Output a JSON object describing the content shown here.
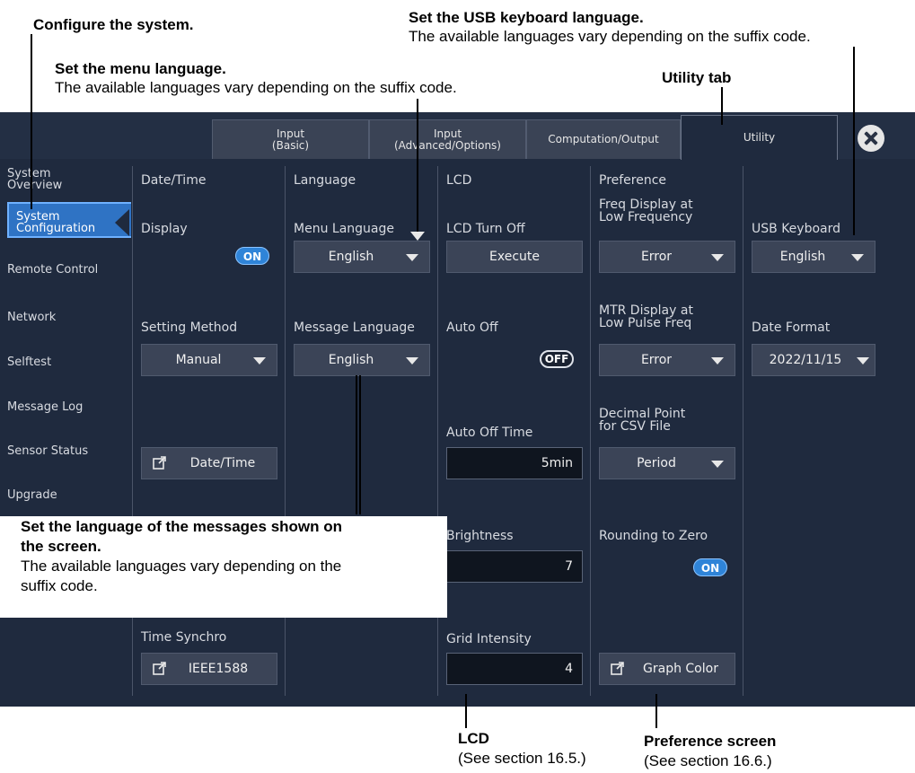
{
  "annotations": {
    "configure": "Configure the system.",
    "usb_title": "Set the USB keyboard language.",
    "usb_body": "The available languages vary depending on the suffix code.",
    "menu_title": "Set the menu language.",
    "menu_body": "The available languages vary depending on the suffix code.",
    "utility_tab": "Utility tab",
    "msg_title_1": "Set the language of the messages shown on",
    "msg_title_2": "the screen.",
    "msg_body_1": "The available languages vary depending on the",
    "msg_body_2": "suffix code.",
    "lcd_title": "LCD",
    "lcd_ref": "(See section 16.5.)",
    "pref_title": "Preference screen",
    "pref_ref": "(See section 16.6.)"
  },
  "tabs": [
    {
      "line1": "Input",
      "line2": "(Basic)"
    },
    {
      "line1": "Input",
      "line2": "(Advanced/Options)"
    },
    {
      "line1": "Computation/Output",
      "line2": ""
    },
    {
      "line1": "Utility",
      "line2": ""
    }
  ],
  "sidebar": [
    {
      "line1": "System",
      "line2": "Overview"
    },
    {
      "line1": "System",
      "line2": "Configuration"
    },
    {
      "line1": "Remote Control",
      "line2": ""
    },
    {
      "line1": "Network",
      "line2": ""
    },
    {
      "line1": "Selftest",
      "line2": ""
    },
    {
      "line1": "Message Log",
      "line2": ""
    },
    {
      "line1": "Sensor Status",
      "line2": ""
    },
    {
      "line1": "Upgrade",
      "line2": ""
    }
  ],
  "datetime": {
    "header": "Date/Time",
    "display_label": "Display",
    "display_value": "ON",
    "setting_method_label": "Setting Method",
    "setting_method_value": "Manual",
    "datetime_button": "Date/Time",
    "time_synchro_label": "Time Synchro",
    "time_synchro_button": "IEEE1588"
  },
  "language": {
    "header": "Language",
    "menu_label": "Menu Language",
    "menu_value": "English",
    "message_label": "Message Language",
    "message_value": "English"
  },
  "lcd": {
    "header": "LCD",
    "turn_off_label": "LCD Turn Off",
    "execute": "Execute",
    "auto_off_label": "Auto Off",
    "auto_off_value": "OFF",
    "auto_off_time_label": "Auto Off Time",
    "auto_off_time_value": "5min",
    "brightness_label": "Brightness",
    "brightness_value": "7",
    "grid_label": "Grid Intensity",
    "grid_value": "4"
  },
  "preference": {
    "header": "Preference",
    "freq_label_1": "Freq Display at",
    "freq_label_2": "Low Frequency",
    "freq_value": "Error",
    "mtr_label_1": "MTR Display at",
    "mtr_label_2": "Low Pulse Freq",
    "mtr_value": "Error",
    "decimal_label_1": "Decimal Point",
    "decimal_label_2": "for CSV File",
    "decimal_value": "Period",
    "rounding_label": "Rounding to Zero",
    "rounding_value": "ON",
    "graph_color": "Graph Color"
  },
  "usb": {
    "label": "USB Keyboard",
    "value": "English",
    "date_format_label": "Date Format",
    "date_format_value": "2022/11/15"
  },
  "colors": {
    "panel_bg": "#1f2a3e",
    "active_item": "#2f73c4",
    "toggle_on": "#2f84d8"
  }
}
